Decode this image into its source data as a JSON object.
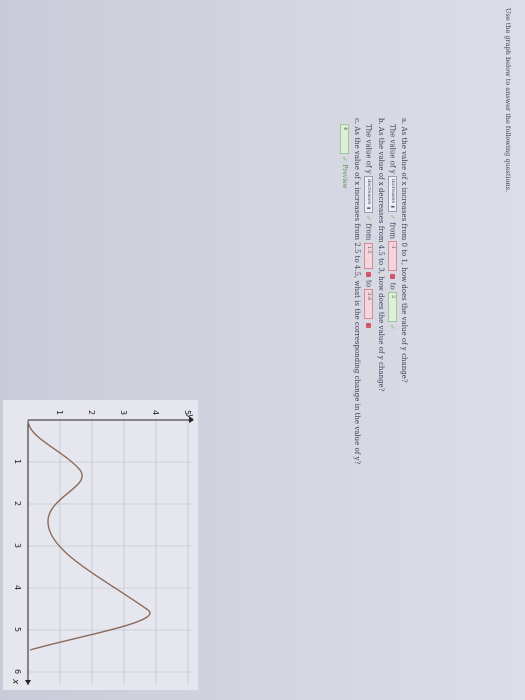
{
  "instruction": "Use the graph below to answer the following questions.",
  "questions": {
    "a": {
      "prompt": "a. As the value of x increases from 0 to 1, how does the value of y change?",
      "label": "The value of y",
      "selection": "increases",
      "from_label": "from",
      "from_value": "-1",
      "to_label": "to",
      "to_value": "2"
    },
    "b": {
      "prompt": "b. As the value of x decreases from 4.5 to 3, how does the value of y change?",
      "label": "The value of y",
      "selection": "decreases",
      "from_label": "from",
      "from_value": "1.5",
      "to_label": "to",
      "to_value": "3.6"
    },
    "c": {
      "prompt": "c. As the value of x increases from 2.5 to 4.5, what is the corresponding change in the value of y?",
      "answer": "4",
      "preview_label": "Preview"
    }
  },
  "graph": {
    "y_axis_label": "y",
    "x_axis_label": "x",
    "x_ticks": [
      "1",
      "2",
      "3",
      "4",
      "5",
      "6"
    ],
    "y_ticks": [
      "1",
      "2",
      "3",
      "4",
      "5"
    ]
  },
  "colors": {
    "text": "#3a3f58",
    "incorrect_border": "#d88a9a",
    "correct_border": "#9cc98f",
    "curve": "#8a6a5c"
  }
}
